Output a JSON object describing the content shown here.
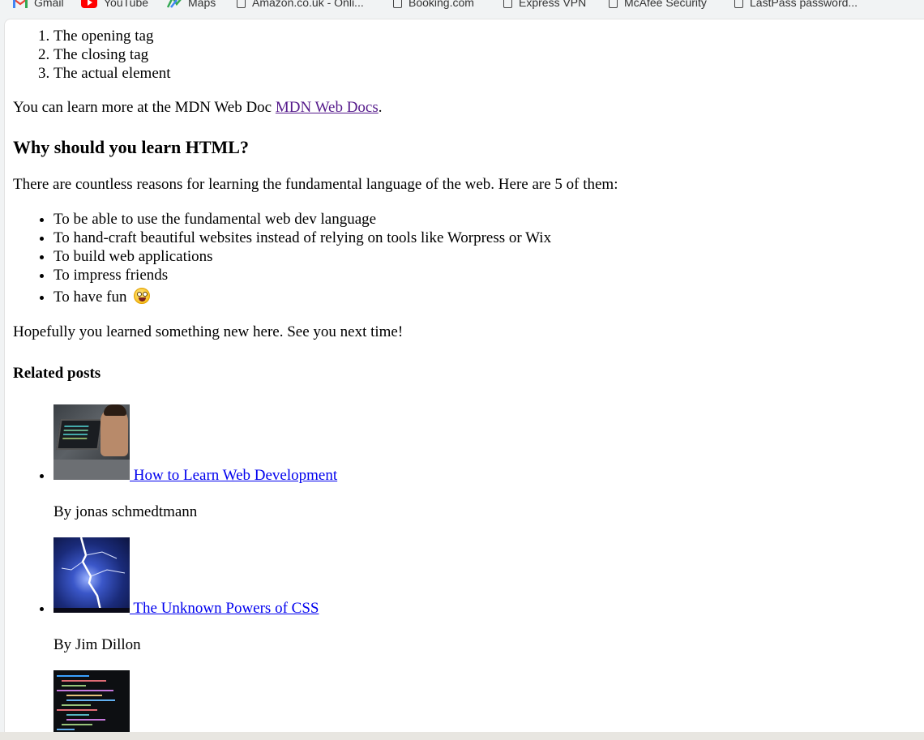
{
  "bookmarks": [
    {
      "label": "Gmail",
      "icon": "gmail-icon"
    },
    {
      "label": "YouTube",
      "icon": "youtube-icon"
    },
    {
      "label": "Maps",
      "icon": "maps-icon"
    },
    {
      "label": "Amazon.co.uk - Onli...",
      "icon": "page-icon"
    },
    {
      "label": "Booking.com",
      "icon": "page-icon"
    },
    {
      "label": "Express VPN",
      "icon": "page-icon"
    },
    {
      "label": "McAfee Security",
      "icon": "page-icon"
    },
    {
      "label": "LastPass password...",
      "icon": "page-icon"
    }
  ],
  "article": {
    "ordered_list": [
      "The opening tag",
      "The closing tag",
      "The actual element"
    ],
    "mdn_text": "You can learn more at the MDN Web Doc ",
    "mdn_link": "MDN Web Docs",
    "mdn_suffix": ".",
    "why_heading": "Why should you learn HTML?",
    "reasons_intro": "There are countless reasons for learning the fundamental language of the web. Here are 5 of them:",
    "reasons": [
      "To be able to use the fundamental web dev language",
      "To hand-craft beautiful websites instead of relying on tools like Worpress or Wix",
      "To build web applications",
      "To impress friends",
      "To have fun"
    ],
    "reasons_last_icon": "grinning-face-emoji-icon",
    "closing": "Hopefully you learned something new here. See you next time!",
    "related_heading": "Related posts",
    "posts": [
      {
        "title": " How to Learn Web Development",
        "author": "By jonas schmedtmann",
        "image": "person-coding-laptop-image"
      },
      {
        "title": " The Unknown Powers of CSS",
        "author": "By Jim Dillon",
        "image": "lightning-bolt-image"
      },
      {
        "title": "",
        "author": "",
        "image": "code-screen-image"
      }
    ]
  },
  "colors": {
    "link": "#0000ee",
    "visited_link": "#551a8b",
    "youtube_red": "#ff0000"
  }
}
